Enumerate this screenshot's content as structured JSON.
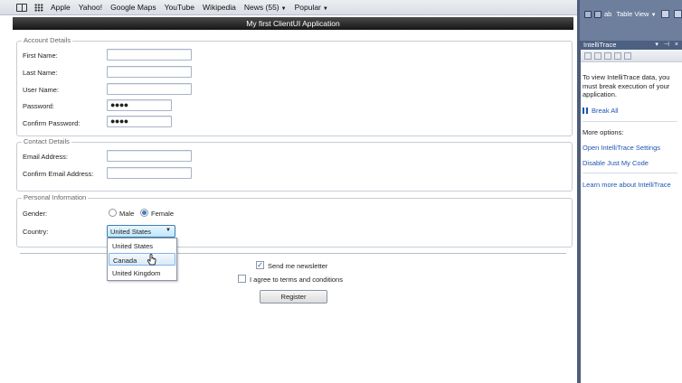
{
  "bookmarks": {
    "items": [
      {
        "label": "Apple"
      },
      {
        "label": "Yahoo!"
      },
      {
        "label": "Google Maps"
      },
      {
        "label": "YouTube"
      },
      {
        "label": "Wikipedia"
      },
      {
        "label": "News (55)",
        "has_menu": true
      },
      {
        "label": "Popular",
        "has_menu": true
      }
    ]
  },
  "app": {
    "title": "My first ClientUI Application"
  },
  "account": {
    "legend": "Account Details",
    "first_name_label": "First Name:",
    "last_name_label": "Last Name:",
    "user_name_label": "User Name:",
    "password_label": "Password:",
    "password_value": "●●●●",
    "confirm_password_label": "Confirm Password:",
    "confirm_password_value": "●●●●"
  },
  "contact": {
    "legend": "Contact Details",
    "email_label": "Email Address:",
    "confirm_email_label": "Confirm Email Address:"
  },
  "personal": {
    "legend": "Personal Information",
    "gender_label": "Gender:",
    "male_label": "Male",
    "female_label": "Female",
    "gender_selected": "Female",
    "country_label": "Country:",
    "country_selected": "United States",
    "country_options": [
      "United States",
      "Canada",
      "United Kingdom"
    ],
    "country_hovered": "Canada"
  },
  "form": {
    "newsletter_label": "Send me newsletter",
    "newsletter_checked": true,
    "terms_label": "I agree to terms and conditions",
    "terms_checked": false,
    "register_label": "Register"
  },
  "ide": {
    "toolbar_text": "ab",
    "table_view_label": "Table View",
    "panel_title": "IntelliTrace",
    "panel_buttons": "▾ ⊣ ×",
    "info_text": "To view IntelliTrace data, you must break execution of your application.",
    "break_all": "Break All",
    "more_options": "More options:",
    "open_settings": "Open IntelliTrace Settings",
    "disable_jmc": "Disable Just My Code",
    "learn_more": "Learn more about IntelliTrace"
  }
}
